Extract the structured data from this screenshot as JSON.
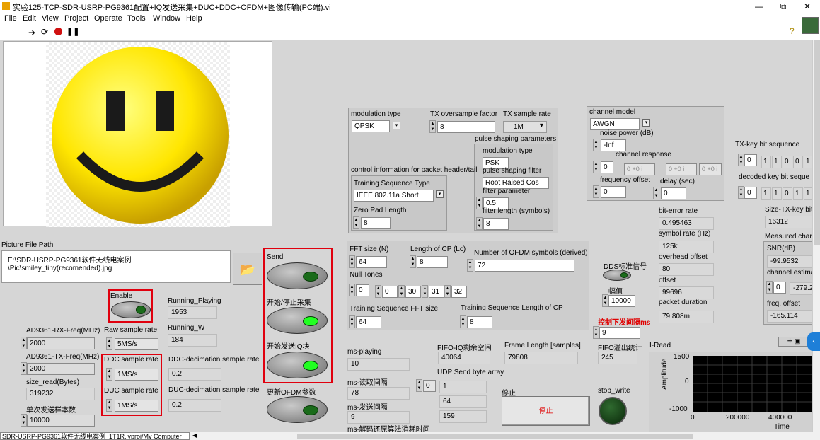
{
  "window": {
    "title": "实验125-TCP-SDR-USRP-PG9361配置+IQ发送采集+DUC+DDC+OFDM+图像传输(PC端).vi",
    "minimize": "—",
    "restore": "⧉",
    "close": "✕"
  },
  "menu": [
    "File",
    "Edit",
    "View",
    "Project",
    "Operate",
    "Tools",
    "Window",
    "Help"
  ],
  "picture": {
    "path_label": "Picture File Path",
    "path_value": "E:\\SDR-USRP-PG9361软件无线电案例\\Pic\\smiley_tiny(recomended).jpg"
  },
  "enable": {
    "label": "Enable"
  },
  "running": {
    "playing_label": "Running_Playing",
    "playing_value": "1953",
    "w_label": "Running_W",
    "w_value": "184"
  },
  "rf": {
    "rx_label": "AD9361-RX-Freq(MHz)",
    "rx_value": "2000",
    "tx_label": "AD9361-TX-Freq(MHz)",
    "tx_value": "2000",
    "size_read_label": "size_read(Bytes)",
    "size_read_value": "319232",
    "send_count_label": "单次发送样本数",
    "send_count_value": "10000"
  },
  "rates": {
    "raw_label": "Raw sample rate",
    "raw_value": "5MS/s",
    "ddc_label": "DDC sample rate",
    "ddc_value": "1MS/s",
    "duc_label": "DUC sample rate",
    "duc_value": "1MS/s",
    "ddc_dec_label": "DDC-decimation sample rate",
    "ddc_dec_value": "0.2",
    "duc_dec_label": "DUC-decimation sample rate",
    "duc_dec_value": "0.2"
  },
  "buttons": {
    "send": "Send",
    "start_stop": "开始/停止采集",
    "start_iq": "开始发送IQ块",
    "update_ofdm": "更新OFDM参数"
  },
  "tx": {
    "mod_type_label": "modulation type",
    "mod_type_value": "QPSK",
    "oversample_label": "TX oversample factor",
    "oversample_value": "8",
    "rate_label": "TX sample rate",
    "rate_value": "1M",
    "psp_label": "pulse shaping parameters",
    "psp_mod_label": "modulation type",
    "psp_mod_value": "PSK",
    "psf_label": "pulse shaping filter",
    "psf_value": "Root Raised Cos",
    "fp_label": "filter parameter",
    "fp_value": "0.5",
    "fl_label": "filter length (symbols)",
    "fl_value": "8",
    "ctrl_info_label": "control information for packet header/tail",
    "tst_label": "Training Sequence Type",
    "tst_value": "IEEE 802.11a Short",
    "zpl_label": "Zero Pad Length",
    "zpl_value": "8"
  },
  "channel": {
    "model_label": "channel model",
    "model_value": "AWGN",
    "np_label": "noise power (dB)",
    "np_value": "-Inf",
    "resp_label": "channel response",
    "resp_values": [
      "0",
      "0 +0 i",
      "0 +0 i",
      "0 +0 i"
    ],
    "fo_label": "frequency offset",
    "fo_value": "0",
    "delay_label": "delay (sec)",
    "delay_value": "0"
  },
  "stats": {
    "ber_label": "bit-error rate",
    "ber_value": "0.495463",
    "symrate_label": "symbol rate (Hz)",
    "symrate_value": "125k",
    "overhead_label": "overhead offset",
    "overhead_value": "80",
    "offset_label": "offset",
    "offset_value": "99696",
    "pd_label": "packet duration",
    "pd_value": "79.808m"
  },
  "right": {
    "txkey_label": "TX-key bit sequence",
    "txkey_index": "0",
    "txkey_bits": [
      "1",
      "1",
      "0",
      "0",
      "1"
    ],
    "dec_label": "decoded key bit seque",
    "dec_index": "0",
    "dec_bits": [
      "1",
      "1",
      "0",
      "1",
      "1"
    ],
    "size_label": "Size-TX-key bit",
    "size_value": "16312",
    "measured_label": "Measured char",
    "snr_label": "SNR(dB)",
    "snr_value": "-99.9532",
    "ce_label": "channel estima",
    "ce_index": "0",
    "ce_value": "-279.2",
    "freq_label": "freq. offset",
    "freq_value": "-165.114"
  },
  "ofdm": {
    "fft_label": "FFT size (N)",
    "fft_value": "64",
    "cp_label": "Length of CP (Lc)",
    "cp_value": "8",
    "nsym_label": "Number of OFDM symbols (derived)",
    "nsym_value": "72",
    "null_label": "Null Tones",
    "null_index": "0",
    "null_values": [
      "0",
      "30",
      "31",
      "32"
    ],
    "tsfft_label": "Training Sequence FFT size",
    "tsfft_value": "64",
    "tscp_label": "Training Sequence Length of CP",
    "tscp_value": "8"
  },
  "dds": {
    "label": "DDS标准信号",
    "amp_label": "幅值",
    "amp_value": "10000",
    "interval_label": "控制下发间隔ms",
    "interval_value": "9"
  },
  "bottom": {
    "msplaying_label": "ms-playing",
    "msplaying_value": "10",
    "msread_label": "ms-读取间隔",
    "msread_value": "78",
    "mssend_label": "ms-发送间隔",
    "mssend_value": "9",
    "msdec_label": "ms-解码还原算法消耗时间",
    "fifo_label": "FIFO-IQ剩余空间",
    "fifo_value": "40064",
    "frame_label": "Frame Length [samples]",
    "frame_value": "79808",
    "fifo_over_label": "FIFO溢出统计",
    "fifo_over_value": "245",
    "udp_label": "UDP Send byte array",
    "udp_index": "0",
    "udp_values": [
      "1",
      "64",
      "159"
    ],
    "stop_label": "停止",
    "stop_btn": "停止",
    "stop_write_label": "stop_write"
  },
  "iread": {
    "title": "I-Read",
    "ylabel": "Amplitude",
    "xlabel": "Time",
    "yticks": [
      "1500",
      "0",
      "-1000"
    ],
    "xticks": [
      "0",
      "200000",
      "400000"
    ]
  },
  "status": {
    "project": "SDR-USRP-PG9361软件无线电案例_1T1R.lvproj/My Computer"
  }
}
